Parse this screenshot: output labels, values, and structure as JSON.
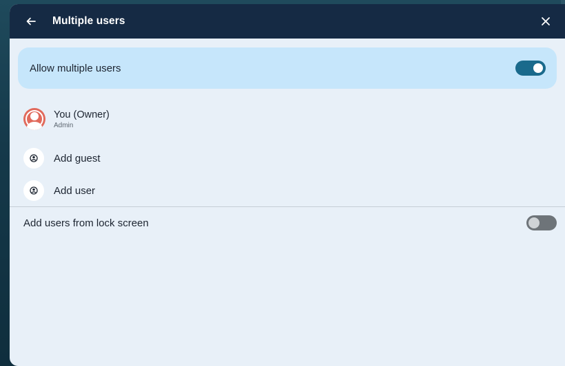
{
  "header": {
    "title": "Multiple users",
    "back_icon": "arrow-left-icon",
    "close_icon": "close-icon",
    "background": "#152a44"
  },
  "allow_multiple": {
    "label": "Allow multiple users",
    "enabled": true,
    "card_color": "#c6e6fb",
    "toggle_color": "#1a6a8c"
  },
  "users": [
    {
      "name": "You (Owner)",
      "role": "Admin",
      "icon": "account-circle-icon",
      "avatar_color": "#e16a5c"
    }
  ],
  "actions": [
    {
      "label": "Add guest",
      "icon": "person-circle-icon"
    },
    {
      "label": "Add user",
      "icon": "person-circle-icon"
    }
  ],
  "lock_screen": {
    "label": "Add users from lock screen",
    "enabled": false
  }
}
